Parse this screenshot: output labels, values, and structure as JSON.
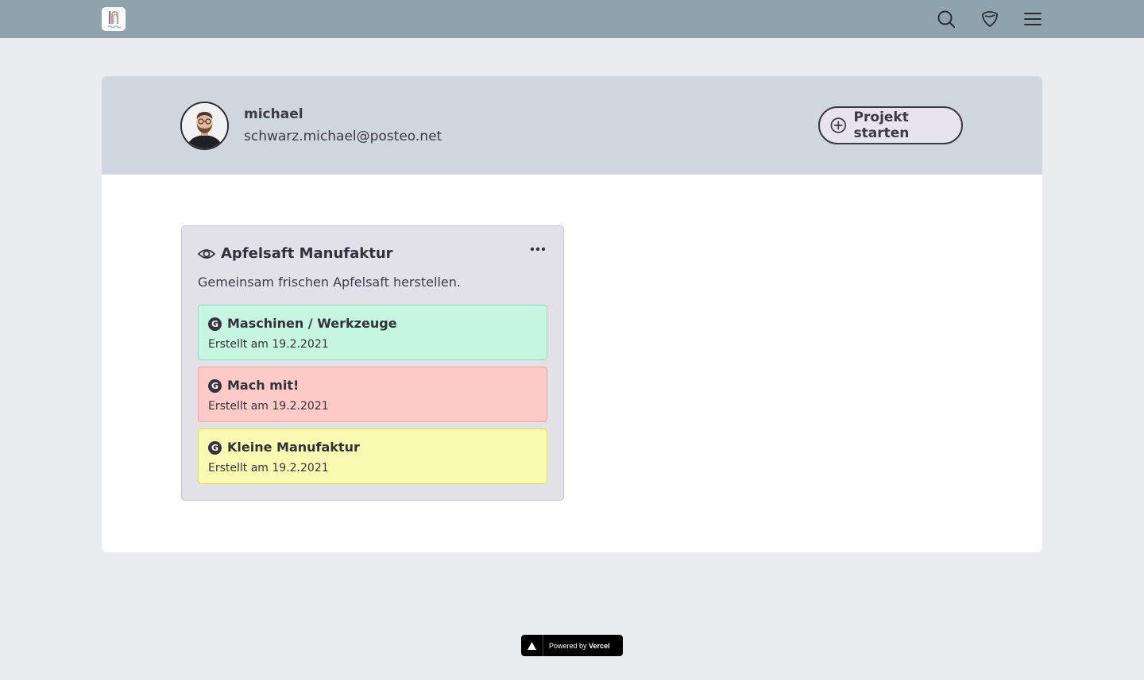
{
  "topbar": {
    "logo_icon": "app-logo-icon",
    "actions": [
      "search-icon",
      "shield-icon",
      "menu-icon"
    ],
    "color": "#8fa3ad"
  },
  "profile": {
    "name": "michael",
    "email": "schwarz.michael@posteo.net",
    "start_button_label": "Projekt starten",
    "start_button_icon": "plus-circle-icon"
  },
  "project": {
    "title": "Apfelsaft Manufaktur",
    "description": "Gemeinsam frischen Apfelsaft herstellen.",
    "title_icon": "eye-icon",
    "menu_icon": "more-horizontal-icon",
    "goals": [
      {
        "badge": "G",
        "title": "Maschinen / Werkzeuge",
        "date": "Erstellt am 19.2.2021",
        "color": "#c6f5e2"
      },
      {
        "badge": "G",
        "title": "Mach mit!",
        "date": "Erstellt am 19.2.2021",
        "color": "#fdcbc7"
      },
      {
        "badge": "G",
        "title": "Kleine Manufaktur",
        "date": "Erstellt am 19.2.2021",
        "color": "#f9fbb2"
      }
    ]
  },
  "footer": {
    "powered_prefix": "Powered by",
    "powered_brand": "Vercel"
  }
}
